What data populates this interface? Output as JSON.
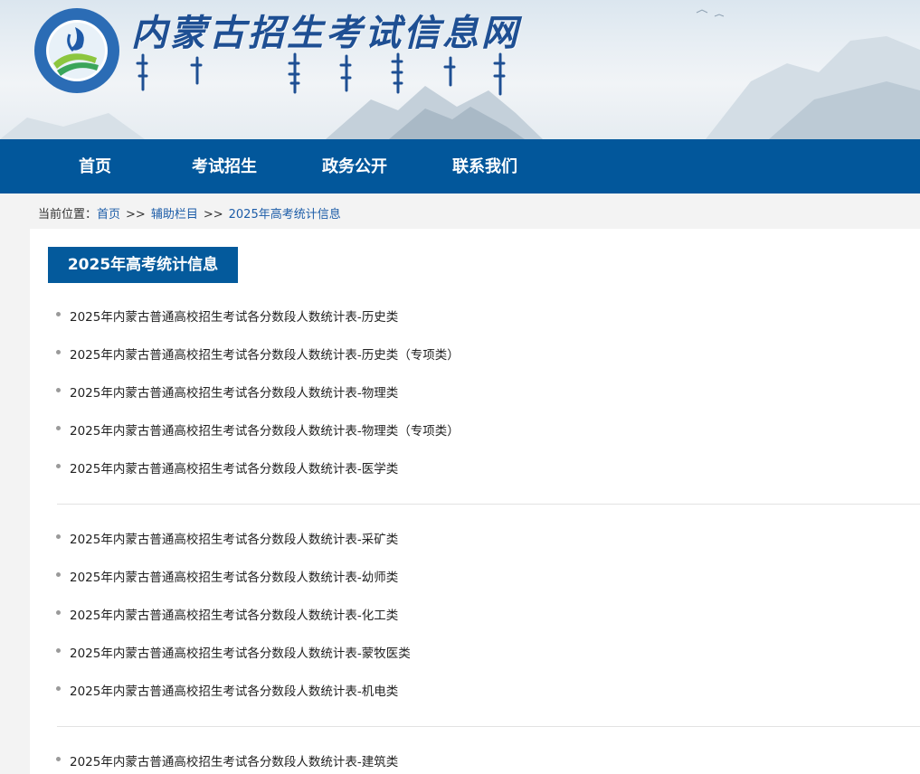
{
  "header": {
    "site_title": "内蒙古招生考试信息网"
  },
  "nav": {
    "items": [
      {
        "label": "首页"
      },
      {
        "label": "考试招生"
      },
      {
        "label": "政务公开"
      },
      {
        "label": "联系我们"
      }
    ]
  },
  "breadcrumb": {
    "prefix": "当前位置：",
    "items": [
      "首页",
      "辅助栏目",
      "2025年高考统计信息"
    ],
    "separator": ">>"
  },
  "section": {
    "title": "2025年高考统计信息",
    "groups": [
      [
        "2025年内蒙古普通高校招生考试各分数段人数统计表-历史类",
        "2025年内蒙古普通高校招生考试各分数段人数统计表-历史类（专项类）",
        "2025年内蒙古普通高校招生考试各分数段人数统计表-物理类",
        "2025年内蒙古普通高校招生考试各分数段人数统计表-物理类（专项类）",
        "2025年内蒙古普通高校招生考试各分数段人数统计表-医学类"
      ],
      [
        "2025年内蒙古普通高校招生考试各分数段人数统计表-采矿类",
        "2025年内蒙古普通高校招生考试各分数段人数统计表-幼师类",
        "2025年内蒙古普通高校招生考试各分数段人数统计表-化工类",
        "2025年内蒙古普通高校招生考试各分数段人数统计表-蒙牧医类",
        "2025年内蒙古普通高校招生考试各分数段人数统计表-机电类"
      ],
      [
        "2025年内蒙古普通高校招生考试各分数段人数统计表-建筑类"
      ]
    ]
  },
  "colors": {
    "nav_bg": "#02579b",
    "title_bg": "#045a9c",
    "link": "#1d5da8",
    "page_bg": "#f3f3f3"
  }
}
